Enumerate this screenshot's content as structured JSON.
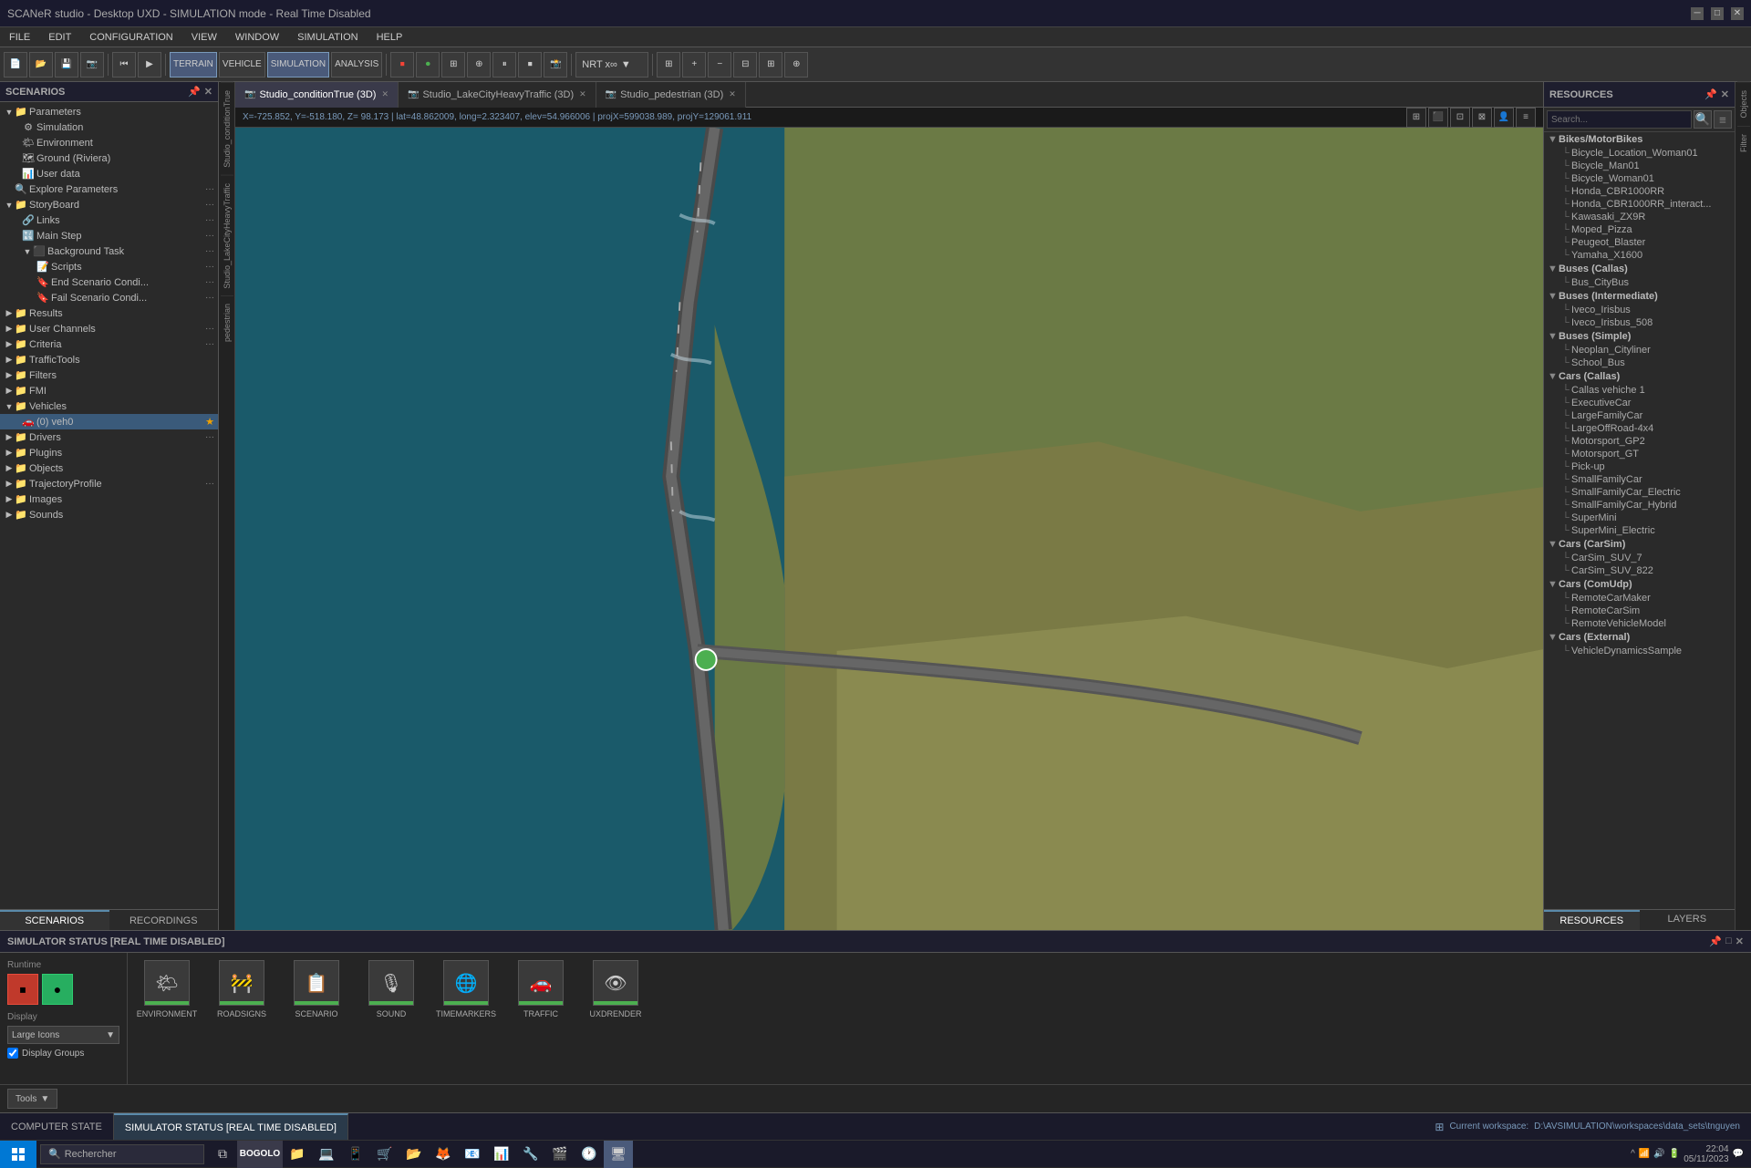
{
  "titlebar": {
    "title": "SCANeR studio - Desktop UXD - SIMULATION mode - Real Time Disabled",
    "controls": [
      "minimize",
      "maximize",
      "close"
    ]
  },
  "menubar": {
    "items": [
      "FILE",
      "EDIT",
      "CONFIGURATION",
      "VIEW",
      "WINDOW",
      "SIMULATION",
      "HELP"
    ]
  },
  "toolbar": {
    "terrain_label": "TERRAIN",
    "vehicle_label": "VEHICLE",
    "simulation_label": "SIMULATION",
    "analysis_label": "ANALYSIS",
    "nrt_label": "NRT x∞"
  },
  "scenarios": {
    "header": "SCENARIOS",
    "tree": [
      {
        "label": "Parameters",
        "level": 0,
        "type": "folder",
        "expanded": true
      },
      {
        "label": "Simulation",
        "level": 1,
        "type": "item"
      },
      {
        "label": "Environment",
        "level": 1,
        "type": "item"
      },
      {
        "label": "Ground (Riviera)",
        "level": 1,
        "type": "item"
      },
      {
        "label": "User data",
        "level": 1,
        "type": "item"
      },
      {
        "label": "Explore Parameters",
        "level": 0,
        "type": "action",
        "more": "···"
      },
      {
        "label": "StoryBoard",
        "level": 0,
        "type": "folder",
        "expanded": true,
        "more": "···"
      },
      {
        "label": "Links",
        "level": 1,
        "type": "item",
        "more": "···"
      },
      {
        "label": "Main Step",
        "level": 1,
        "type": "item",
        "more": "···"
      },
      {
        "label": "Background Task",
        "level": 1,
        "type": "item",
        "expanded": true,
        "more": "···"
      },
      {
        "label": "Scripts",
        "level": 2,
        "type": "scripts"
      },
      {
        "label": "End Scenario Condi...",
        "level": 2,
        "type": "script"
      },
      {
        "label": "Fail Scenario Condi...",
        "level": 2,
        "type": "script"
      },
      {
        "label": "Results",
        "level": 0,
        "type": "folder"
      },
      {
        "label": "User Channels",
        "level": 0,
        "type": "folder",
        "more": "···"
      },
      {
        "label": "Criteria",
        "level": 0,
        "type": "folder",
        "more": "···"
      },
      {
        "label": "TrafficTools",
        "level": 0,
        "type": "folder"
      },
      {
        "label": "Filters",
        "level": 0,
        "type": "folder"
      },
      {
        "label": "FMI",
        "level": 0,
        "type": "folder"
      },
      {
        "label": "Vehicles",
        "level": 0,
        "type": "folder",
        "expanded": true
      },
      {
        "label": "(0) veh0",
        "level": 1,
        "type": "vehicle",
        "selected": true
      },
      {
        "label": "Drivers",
        "level": 0,
        "type": "folder",
        "more": "···"
      },
      {
        "label": "Plugins",
        "level": 0,
        "type": "folder"
      },
      {
        "label": "Objects",
        "level": 0,
        "type": "folder"
      },
      {
        "label": "TrajectoryProfile",
        "level": 0,
        "type": "folder",
        "more": "···"
      },
      {
        "label": "Images",
        "level": 0,
        "type": "folder"
      },
      {
        "label": "Sounds",
        "level": 0,
        "type": "folder"
      }
    ],
    "tabs": [
      "SCENARIOS",
      "RECORDINGS"
    ]
  },
  "viewport": {
    "tabs": [
      {
        "label": "Studio_conditionTrue (3D)",
        "active": true
      },
      {
        "label": "Studio_LakeCityHeavyTraffic (3D)",
        "active": false
      },
      {
        "label": "Studio_pedestrian (3D)",
        "active": false
      }
    ],
    "info": "X=-725.852, Y=-518.180, Z= 98.173 | lat=48.862009, long=2.323407, elev=54.966006 | projX=599038.989, projY=129061.911"
  },
  "resources": {
    "header": "RESOURCES",
    "search_placeholder": "Search...",
    "categories": [
      {
        "label": "Bikes/MotorBikes",
        "items": [
          "Bicycle_Location_Woman01",
          "Bicycle_Man01",
          "Bicycle_Woman01",
          "Honda_CBR1000RR",
          "Honda_CBR1000RR_interact...",
          "Kawasaki_ZX9R",
          "Moped_Pizza",
          "Peugeot_Blaster",
          "Yamaha_X1600"
        ]
      },
      {
        "label": "Buses (Callas)",
        "items": [
          "Bus_CityBus"
        ]
      },
      {
        "label": "Buses (Intermediate)",
        "items": [
          "Iveco_Irisbus",
          "Iveco_Irisbus_508"
        ]
      },
      {
        "label": "Buses (Simple)",
        "items": [
          "Neoplan_Cityliner",
          "School_Bus"
        ]
      },
      {
        "label": "Cars (Callas)",
        "items": [
          "Callas vehiche 1",
          "ExecutiveCar",
          "LargeFamilyCar",
          "LargeOffRoad-4x4",
          "Motorsport_GP2",
          "Motorsport_GT",
          "Pick-up",
          "SmallFamilyCar",
          "SmallFamilyCar_Electric",
          "SmallFamilyCar_Hybrid",
          "SuperMini",
          "SuperMini_Electric"
        ]
      },
      {
        "label": "Cars (CarSim)",
        "items": [
          "CarSim_SUV_7",
          "CarSim_SUV_822"
        ]
      },
      {
        "label": "Cars (ComUdp)",
        "items": [
          "RemoteCarMaker",
          "RemoteCarSim",
          "RemoteVehicleModel"
        ]
      },
      {
        "label": "Cars (External)",
        "items": [
          "VehicleDynamicsSample"
        ]
      }
    ],
    "tabs": [
      "RESOURCES",
      "LAYERS"
    ]
  },
  "simulator_status": {
    "header": "SIMULATOR STATUS [REAL TIME DISABLED]",
    "runtime_label": "Runtime",
    "display_label": "Display",
    "display_option": "Large Icons",
    "display_groups_label": "Display Groups",
    "display_groups_checked": true,
    "modules": [
      {
        "name": "ENVIRONMENT",
        "icon": "🌤",
        "bar": "green"
      },
      {
        "name": "ROADSIGNS",
        "icon": "🚧",
        "bar": "green"
      },
      {
        "name": "SCENARIO",
        "icon": "📋",
        "bar": "green"
      },
      {
        "name": "SOUND",
        "icon": "🎙",
        "bar": "green"
      },
      {
        "name": "TIMEMARKERS",
        "icon": "🌐",
        "bar": "green"
      },
      {
        "name": "TRAFFIC",
        "icon": "🚗",
        "bar": "green"
      },
      {
        "name": "UXDRENDER",
        "icon": "👁",
        "bar": "green"
      }
    ],
    "tools_label": "Tools"
  },
  "status_bar": {
    "tabs": [
      "COMPUTER STATE",
      "SIMULATOR STATUS [REAL TIME DISABLED]"
    ],
    "workspace_label": "Current workspace:",
    "workspace_path": "D:\\AVSIMULATION\\workspaces\\data_sets\\tnguyen"
  },
  "taskbar": {
    "search_placeholder": "Rechercher",
    "time": "22:04",
    "date": "05/11/2023"
  },
  "vertical_labels": {
    "left": [
      "Studio_conditionTrue",
      "Studio_LakeCityHeavyTraffic",
      "pedestrian"
    ],
    "right": [
      "Objects",
      "Filter"
    ]
  }
}
